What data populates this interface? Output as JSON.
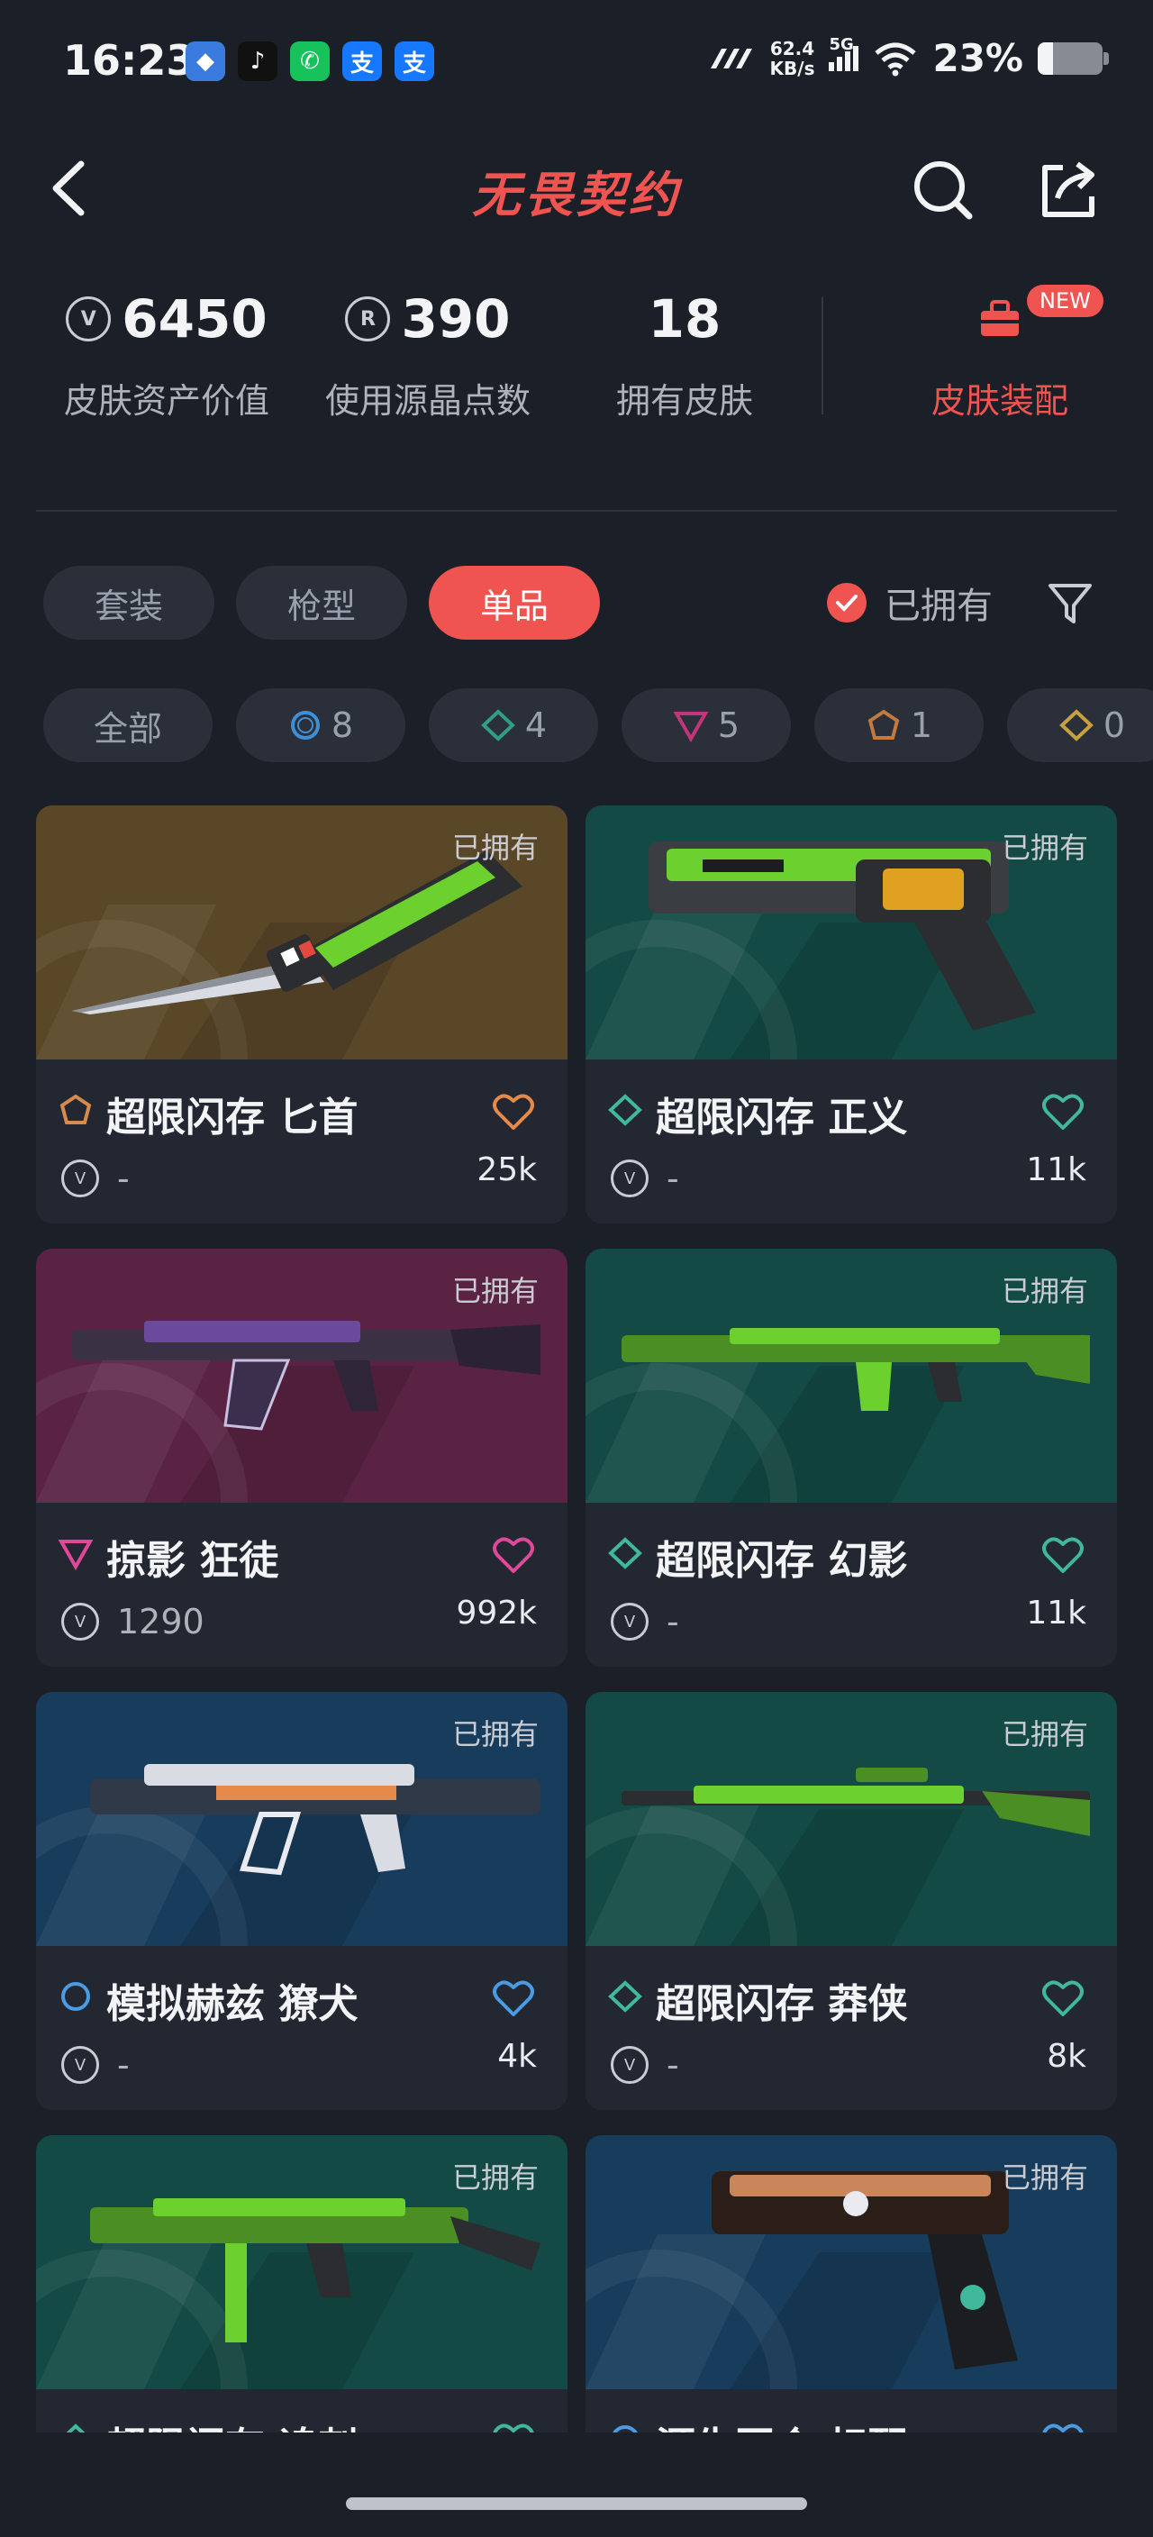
{
  "status": {
    "time": "16:23",
    "net_speed": "62.4",
    "net_unit": "KB/s",
    "signal": "5G",
    "battery_pct": "23%",
    "battery_level": 0.23
  },
  "header": {
    "title": "无畏契约"
  },
  "stats": [
    {
      "value": "6450",
      "label": "皮肤资产价值",
      "icon": "vp-coin-icon"
    },
    {
      "value": "390",
      "label": "使用源晶点数",
      "icon": "radianite-icon"
    },
    {
      "value": "18",
      "label": "拥有皮肤"
    }
  ],
  "equip": {
    "label": "皮肤装配",
    "badge": "NEW"
  },
  "tabs": [
    "套装",
    "枪型",
    "单品"
  ],
  "owned_filter": "已拥有",
  "chips": [
    {
      "label": "全部"
    },
    {
      "count": "8",
      "color": "#3f8fd6",
      "shape": "ring"
    },
    {
      "count": "4",
      "color": "#2f9e86",
      "shape": "diamond"
    },
    {
      "count": "5",
      "color": "#c2357a",
      "shape": "triangle"
    },
    {
      "count": "1",
      "color": "#c27a3f",
      "shape": "pentagon"
    },
    {
      "count": "0",
      "color": "#c9a040",
      "shape": "diamond"
    }
  ],
  "cards": [
    {
      "name": "超限闪存 匕首",
      "price": "-",
      "likes": "25k",
      "owned": "已拥有",
      "tier_color": "#d68a4c",
      "heart_color": "#e58a48",
      "bg": "#5a4728",
      "weapon": "knife"
    },
    {
      "name": "超限闪存 正义",
      "price": "-",
      "likes": "11k",
      "owned": "已拥有",
      "tier_color": "#3fb89c",
      "heart_color": "#3fb89c",
      "bg": "#134a45",
      "weapon": "revolver"
    },
    {
      "name": "掠影 狂徒",
      "price": "1290",
      "likes": "992k",
      "owned": "已拥有",
      "tier_color": "#e0489a",
      "heart_color": "#e0489a",
      "bg": "#5a2344",
      "weapon": "rifle"
    },
    {
      "name": "超限闪存 幻影",
      "price": "-",
      "likes": "11k",
      "owned": "已拥有",
      "tier_color": "#3fb89c",
      "heart_color": "#3fb89c",
      "bg": "#134a45",
      "weapon": "phantom"
    },
    {
      "name": "模拟赫兹 獠犬",
      "price": "-",
      "likes": "4k",
      "owned": "已拥有",
      "tier_color": "#4a9be3",
      "heart_color": "#4a9be3",
      "bg": "#173c5c",
      "weapon": "bulldog"
    },
    {
      "name": "超限闪存 莽侠",
      "price": "-",
      "likes": "8k",
      "owned": "已拥有",
      "tier_color": "#3fb89c",
      "heart_color": "#3fb89c",
      "bg": "#134a45",
      "weapon": "sniper"
    },
    {
      "name": "超限闪存 追刺",
      "price": "",
      "likes": "",
      "owned": "已拥有",
      "tier_color": "#3fb89c",
      "heart_color": "#3fb89c",
      "bg": "#134a45",
      "weapon": "smg"
    },
    {
      "name": "源生回合 标配",
      "price": "",
      "likes": "",
      "owned": "已拥有",
      "tier_color": "#4a9be3",
      "heart_color": "#4a9be3",
      "bg": "#173c5c",
      "weapon": "pistol"
    }
  ]
}
